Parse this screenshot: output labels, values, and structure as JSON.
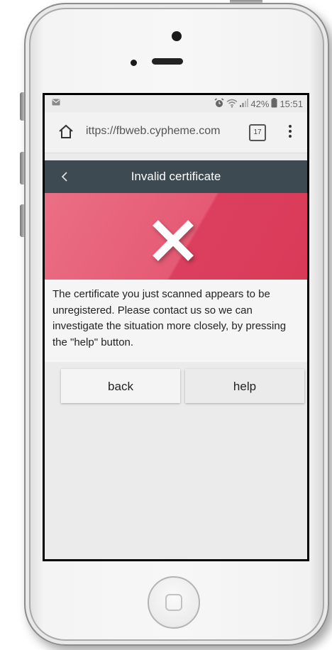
{
  "status_bar": {
    "left_icon": "mail-icon",
    "alarm_icon": "alarm-icon",
    "wifi_icon": "wifi-icon",
    "signal_icon": "signal-icon",
    "battery_percent": "42%",
    "battery_icon": "battery-icon",
    "time": "15:51"
  },
  "browser": {
    "home_icon": "home-icon",
    "url": "ittps://fbweb.cypheme.com",
    "tab_count": "17",
    "menu_icon": "more-vert-icon"
  },
  "app_header": {
    "back_icon": "chevron-left-icon",
    "title": "Invalid certificate"
  },
  "banner": {
    "icon": "x-icon",
    "color_left": "#ea6f85",
    "color_right": "#dc3f5e"
  },
  "message": {
    "text": "The certificate you just scanned appears to be unregistered. Please contact us so we can investigate the situation more closely, by pressing the \"help\" button."
  },
  "actions": {
    "back_label": "back",
    "help_label": "help"
  },
  "colors": {
    "header_bg": "#3d4a52",
    "screen_bg": "#ebebeb"
  }
}
